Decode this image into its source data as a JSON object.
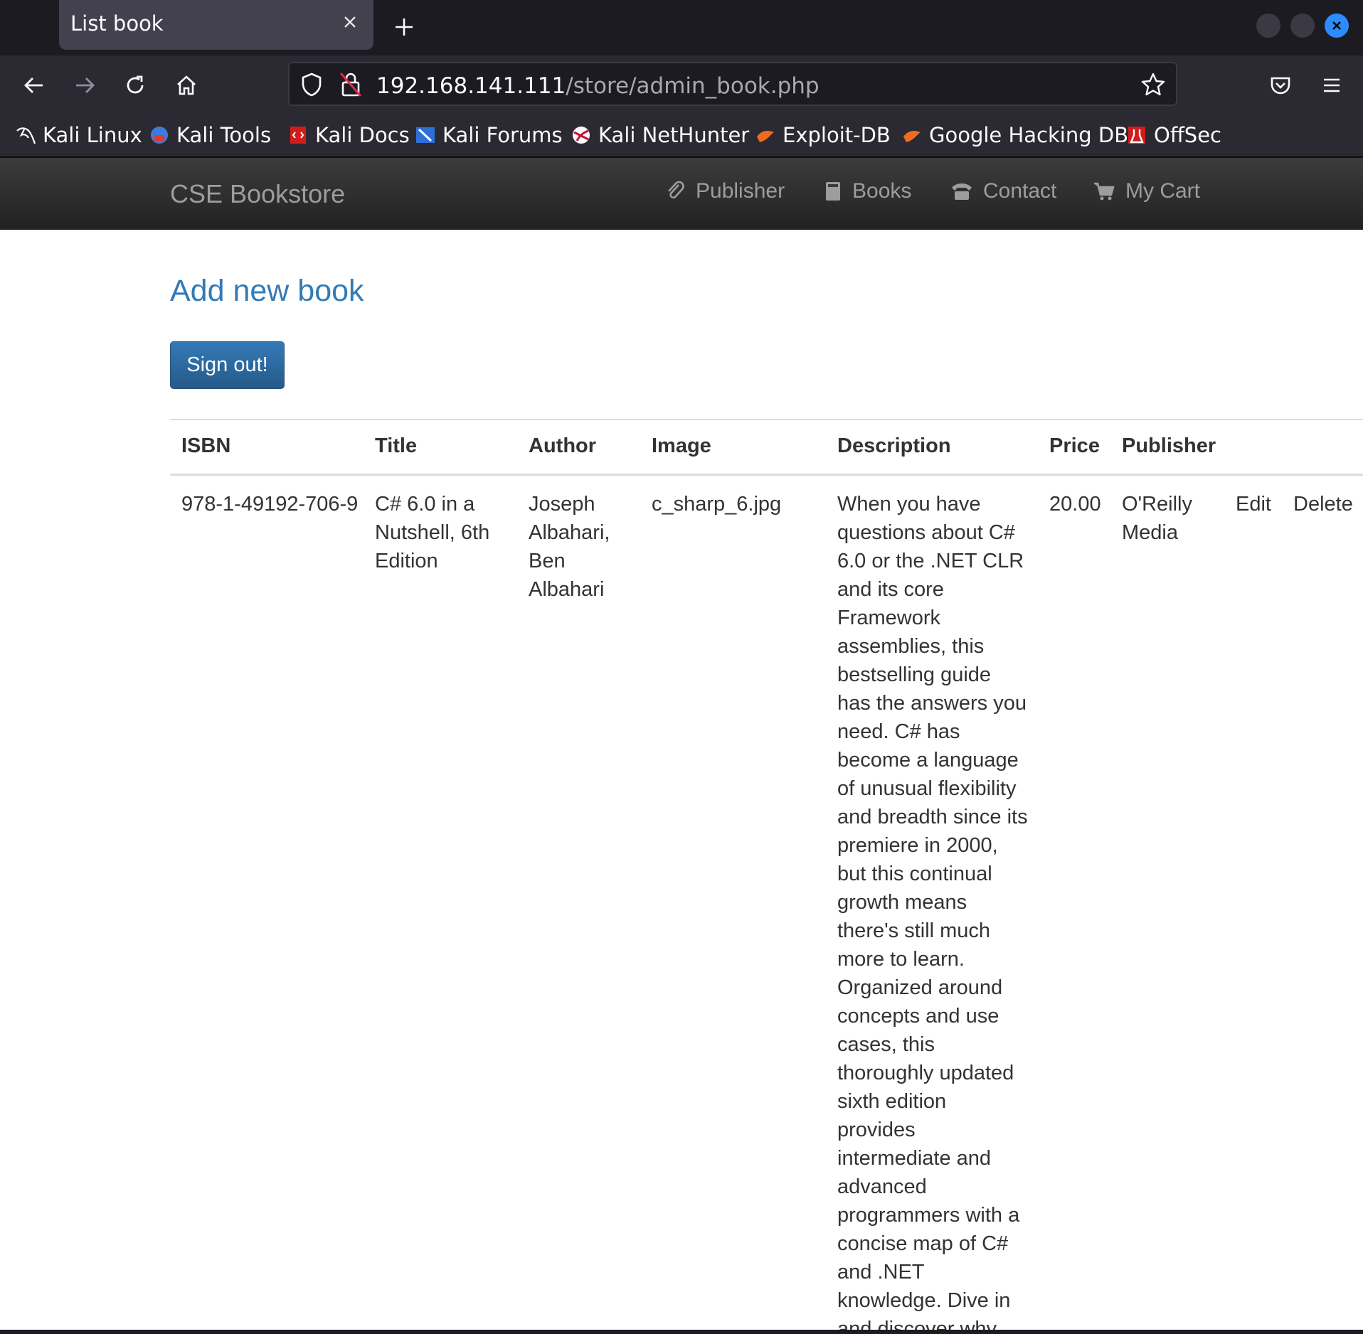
{
  "browser": {
    "tab_title": "List book",
    "url_host": "192.168.141.111",
    "url_path": "/store/admin_book.php",
    "bookmarks": [
      "Kali Linux",
      "Kali Tools",
      "Kali Docs",
      "Kali Forums",
      "Kali NetHunter",
      "Exploit-DB",
      "Google Hacking DB",
      "OffSec"
    ]
  },
  "site": {
    "brand": "CSE Bookstore",
    "nav": [
      "Publisher",
      "Books",
      "Contact",
      "My Cart"
    ]
  },
  "main": {
    "add_link": "Add new book",
    "signout_label": "Sign out!",
    "table": {
      "headers": [
        "ISBN",
        "Title",
        "Author",
        "Image",
        "Description",
        "Price",
        "Publisher"
      ],
      "rows": [
        {
          "isbn": "978-1-49192-706-9",
          "title": "C# 6.0 in a Nutshell, 6th Edition",
          "author": "Joseph Albahari, Ben Albahari",
          "image": "c_sharp_6.jpg",
          "description": "When you have questions about C# 6.0 or the .NET CLR and its core Framework assemblies, this bestselling guide has the answers you need. C# has become a language of unusual flexibility and breadth since its premiere in 2000, but this continual growth means there's still much more to learn. Organized around concepts and use cases, this thoroughly updated sixth edition provides intermediate and advanced programmers with a concise map of C# and .NET knowledge. Dive in and discover why this Nutshell guide is considered the",
          "price": "20.00",
          "publisher": "O'Reilly Media",
          "edit": "Edit",
          "delete": "Delete"
        }
      ]
    }
  },
  "colors": {
    "link": "#337ab7",
    "navbar_bg": "#222222",
    "browser_bg": "#1c1b22"
  }
}
